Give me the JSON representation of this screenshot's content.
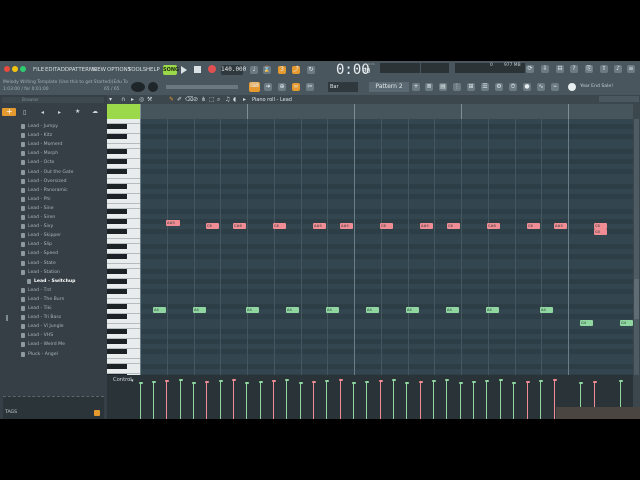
{
  "menu": [
    "FILE",
    "EDIT",
    "ADD",
    "PATTERNS",
    "VIEW",
    "OPTIONS",
    "TOOLS",
    "HELP"
  ],
  "transport": {
    "song_label": "SONG",
    "tempo": "140.000",
    "time": "0:00",
    "time_sub": "00",
    "time_label": "M:S:CS"
  },
  "hint": {
    "line1": "Melody Writing Template (Use this to get Started)(Edu To",
    "line2": "1:03:00 / for 0:01:00",
    "counter": "65 / 65"
  },
  "cpu": {
    "value1": "977 MB",
    "value2": "0"
  },
  "pattern": {
    "name": "Pattern 2",
    "snap": "Bar"
  },
  "promo": "Year End Sale!",
  "piano_roll": {
    "title": "Piano roll - Lead"
  },
  "browser": {
    "search_placeholder": "Browser",
    "items": [
      "Lead - Jumpy",
      "Lead - Kitz",
      "Lead - Moment",
      "Lead - Morph",
      "Lead - Octo",
      "Lead - Out the Gate",
      "Lead - Oversized",
      "Lead - Panoramic",
      "Lead - Phi",
      "Lead - Sine",
      "Lead - Siren",
      "Lead - Sixy",
      "Lead - Skipper",
      "Lead - Slip",
      "Lead - Speed",
      "Lead - State",
      "Lead - Station",
      "Lead - Switchup",
      "Lead - Tnt",
      "Lead - The Burn",
      "Lead - Tiki",
      "Lead - Tri Bass",
      "Lead - Vi Jungle",
      "Lead - VHS",
      "Lead - Weird Me",
      "Pluck - Angel"
    ],
    "selected_index": 17,
    "tags_label": "TAGS"
  },
  "control_label": "Control",
  "notes_pink": [
    "A#5",
    "C6",
    "C#6",
    "C6",
    "A#5",
    "A#5",
    "C6",
    "A#5",
    "C6",
    "C#6",
    "C6",
    "A#5",
    "C6",
    "G5"
  ],
  "notes_green_mid": [
    "A4",
    "A4",
    "A4",
    "A4",
    "A4",
    "A4",
    "A4",
    "A4",
    "A4",
    "A4",
    "G4",
    "G4"
  ],
  "notes_green_low": [
    "C4",
    "C4",
    "C4",
    "C4",
    "C4",
    "C4",
    "C4",
    "C4",
    "C4",
    "C4"
  ],
  "colors": {
    "accent": "#9bd84a",
    "pink": "#f08c93",
    "green": "#8fd6a0",
    "roll_bg": "#33454f"
  }
}
